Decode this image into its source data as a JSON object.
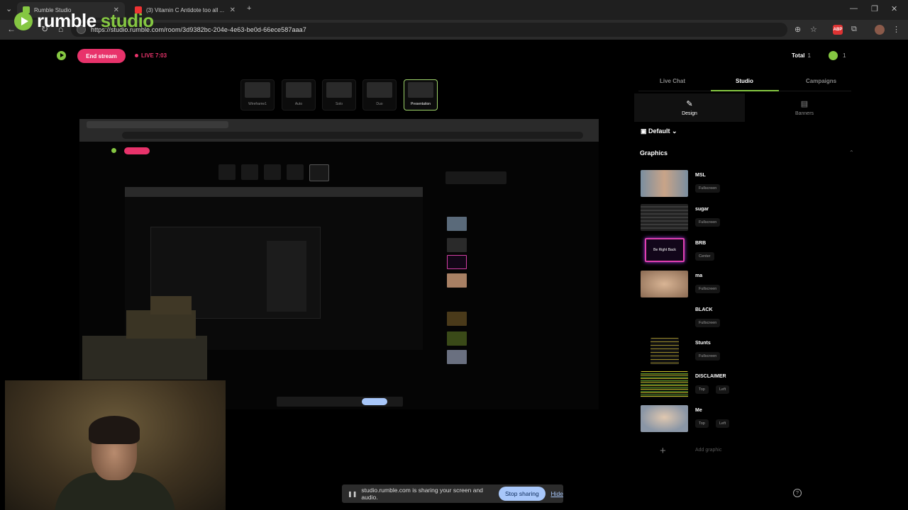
{
  "browser": {
    "tabs": [
      {
        "label": "Rumble Studio",
        "favicon_color": "#85c742"
      },
      {
        "label": "(3) Vitamin C Antidote too all ...",
        "favicon_color": "#e33"
      }
    ],
    "url": "https://studio.rumble.com/room/3d9382bc-204e-4e63-be0d-66ece587aaa7"
  },
  "brand": {
    "word1": "rumble",
    "word2": "studio"
  },
  "topbar": {
    "end_stream": "End stream",
    "live": "LIVE 7:03",
    "total_label": "Total",
    "total_value": "1",
    "viewers": "1"
  },
  "layouts": [
    "Wireframe1",
    "Auto",
    "Solo",
    "Duo",
    "Presentation"
  ],
  "right_panel": {
    "tabs": [
      "Live Chat",
      "Studio",
      "Campaigns"
    ],
    "subtabs": [
      "Design",
      "Banners"
    ],
    "theme": "Default",
    "graphics_heading": "Graphics",
    "graphics": [
      {
        "name": "MSL",
        "chips": [
          "Fullscreen"
        ]
      },
      {
        "name": "sugar",
        "chips": [
          "Fullscreen"
        ]
      },
      {
        "name": "BRB",
        "chips": [
          "Center"
        ]
      },
      {
        "name": "ma",
        "chips": [
          "Fullscreen"
        ]
      },
      {
        "name": "BLACK",
        "chips": [
          "Fullscreen"
        ]
      },
      {
        "name": "Stunts",
        "chips": [
          "Fullscreen"
        ]
      },
      {
        "name": "DISCLAIMER",
        "chips": [
          "Top",
          "Left"
        ]
      },
      {
        "name": "Me",
        "chips": [
          "Top",
          "Left"
        ]
      }
    ],
    "brb_text": "Be Right Back",
    "add_graphic": "Add graphic"
  },
  "share_bar": {
    "message": "studio.rumble.com is sharing your screen and audio.",
    "stop": "Stop sharing",
    "hide": "Hide"
  },
  "colors": {
    "accent": "#85c742",
    "live": "#e8336b",
    "chip_blue": "#a8c7fa"
  }
}
